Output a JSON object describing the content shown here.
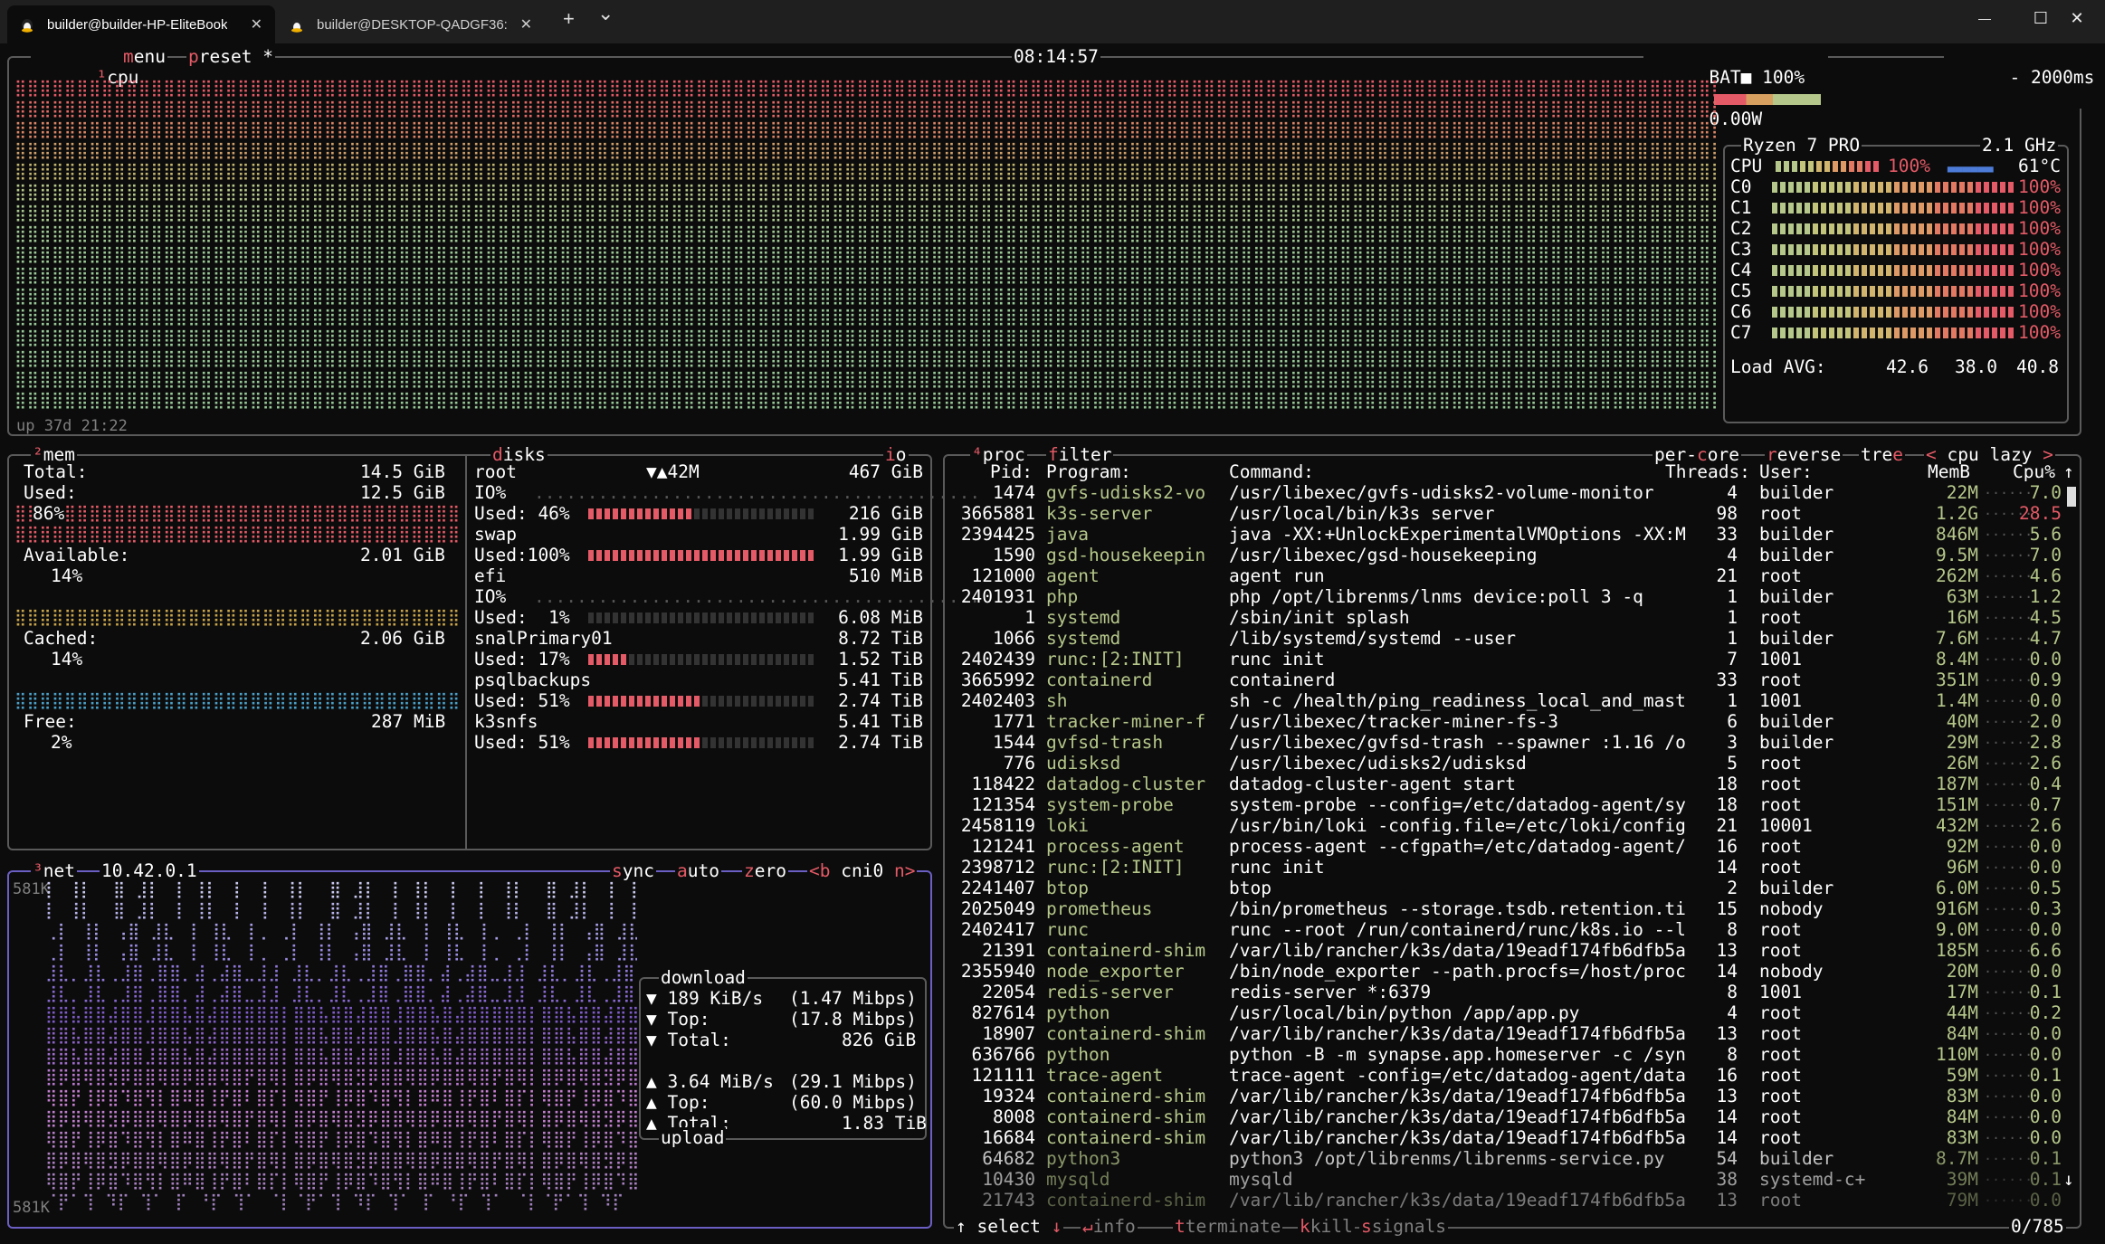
{
  "window": {
    "tabs": [
      {
        "title": "builder@builder-HP-EliteBook",
        "active": true
      },
      {
        "title": "builder@DESKTOP-QADGF36:",
        "active": false
      }
    ],
    "new_tab": "+",
    "dropdown": "⌄",
    "close_glyph": "✕",
    "controls": {
      "minimize": "—",
      "maximize": "☐",
      "close": "✕"
    }
  },
  "colors": {
    "accent_red": "#e45a66",
    "green": "#b5c78a",
    "border_gray": "#5a5a5a",
    "purple_border": "#6b5fc4"
  },
  "cpu": {
    "tab_num": "¹",
    "label": "cpu",
    "menu": "menu",
    "preset": "preset *",
    "clock": "08:14:57",
    "battery": "BAT■ 100%",
    "power": "0.00W",
    "interval": "2000ms",
    "minus": "-",
    "plus": "+",
    "uptime": "up 37d 21:22",
    "model": "Ryzen 7 PRO",
    "freq": "2.1 GHz",
    "total_label": "CPU",
    "total_pct": "100%",
    "temp": "61°C",
    "total_fraction": 1.0,
    "cores": [
      {
        "name": "C0",
        "pct": "100%",
        "value": 1.0
      },
      {
        "name": "C1",
        "pct": "100%",
        "value": 1.0
      },
      {
        "name": "C2",
        "pct": "100%",
        "value": 1.0
      },
      {
        "name": "C3",
        "pct": "100%",
        "value": 1.0
      },
      {
        "name": "C4",
        "pct": "100%",
        "value": 1.0
      },
      {
        "name": "C5",
        "pct": "100%",
        "value": 1.0
      },
      {
        "name": "C6",
        "pct": "100%",
        "value": 1.0
      },
      {
        "name": "C7",
        "pct": "100%",
        "value": 1.0
      }
    ],
    "load_label": "Load AVG:",
    "load": [
      "42.6",
      "38.0",
      "40.8"
    ]
  },
  "mem": {
    "tab_num": "²",
    "label": "mem",
    "total_label": "Total:",
    "total": "14.5 GiB",
    "used_label": "Used:",
    "used": "12.5 GiB",
    "used_pct": "86%",
    "available_label": "Available:",
    "available": "2.01 GiB",
    "available_pct": "14%",
    "cached_label": "Cached:",
    "cached": "2.06 GiB",
    "cached_pct": "14%",
    "free_label": "Free:",
    "free": "287 MiB",
    "free_pct": "2%"
  },
  "disks": {
    "label": "disks",
    "io_label": "io",
    "items": [
      {
        "name": "root",
        "io": "▼▲42M",
        "size": "467 GiB",
        "io_label": "IO%",
        "used_label": "Used: 46%",
        "used": "216 GiB",
        "fraction": 0.46
      },
      {
        "name": "swap",
        "size": "1.99 GiB",
        "used_label": "Used:100%",
        "used": "1.99 GiB",
        "fraction": 1.0
      },
      {
        "name": "efi",
        "size": "510 MiB",
        "io_label": "IO%",
        "used_label": "Used:  1%",
        "used": "6.08 MiB",
        "fraction": 0.01
      },
      {
        "name": "snalPrimary01",
        "size": "8.72 TiB",
        "used_label": "Used: 17%",
        "used": "1.52 TiB",
        "fraction": 0.17
      },
      {
        "name": "psqlbackups",
        "size": "5.41 TiB",
        "used_label": "Used: 51%",
        "used": "2.74 TiB",
        "fraction": 0.51
      },
      {
        "name": "k3snfs",
        "size": "5.41 TiB",
        "used_label": "Used: 51%",
        "used": "2.74 TiB",
        "fraction": 0.51
      }
    ]
  },
  "net": {
    "tab_num": "³",
    "label": "net",
    "ip": "10.42.0.1",
    "sync": "sync",
    "auto": "auto",
    "zero": "zero",
    "prev": "<b",
    "iface": "cni0",
    "next": "n>",
    "scale_top": "581K",
    "scale_bottom": "581K",
    "download_title": "download",
    "download_rate": "189 KiB/s",
    "download_mbps": "(1.47 Mibps)",
    "download_top_label": "Top:",
    "download_top": "(17.8 Mibps)",
    "download_total_label": "Total:",
    "download_total": "826 GiB",
    "upload_rate": "3.64 MiB/s",
    "upload_mbps": "(29.1 Mibps)",
    "upload_top_label": "Top:",
    "upload_top": "(60.0 Mibps)",
    "upload_total_label": "Total:",
    "upload_total": "1.83 TiB",
    "upload_title": "upload"
  },
  "proc": {
    "tab_num": "⁴",
    "label": "proc",
    "filter": "filter",
    "per_core": "per-core",
    "reverse": "reverse",
    "tree": "tree",
    "sort_prev": "<",
    "sort": "cpu lazy",
    "sort_next": ">",
    "columns": {
      "pid": "Pid:",
      "program": "Program:",
      "command": "Command:",
      "threads": "Threads:",
      "user": "User:",
      "mem": "MemB",
      "cpu": "Cpu%"
    },
    "rows": [
      {
        "pid": "1474",
        "program": "gvfs-udisks2-vo",
        "command": "/usr/libexec/gvfs-udisks2-volume-monitor",
        "threads": "4",
        "user": "builder",
        "mem": "22M",
        "cpu": "7.0"
      },
      {
        "pid": "3665881",
        "program": "k3s-server",
        "command": "/usr/local/bin/k3s server",
        "threads": "98",
        "user": "root",
        "mem": "1.2G",
        "cpu": "28.5"
      },
      {
        "pid": "2394425",
        "program": "java",
        "command": "java -XX:+UnlockExperimentalVMOptions -XX:M",
        "threads": "33",
        "user": "builder",
        "mem": "846M",
        "cpu": "5.6"
      },
      {
        "pid": "1590",
        "program": "gsd-housekeepin",
        "command": "/usr/libexec/gsd-housekeeping",
        "threads": "4",
        "user": "builder",
        "mem": "9.5M",
        "cpu": "7.0"
      },
      {
        "pid": "121000",
        "program": "agent",
        "command": "agent run",
        "threads": "21",
        "user": "root",
        "mem": "262M",
        "cpu": "4.6"
      },
      {
        "pid": "2401931",
        "program": "php",
        "command": "php /opt/librenms/lnms device:poll 3 -q",
        "threads": "1",
        "user": "builder",
        "mem": "63M",
        "cpu": "1.2"
      },
      {
        "pid": "1",
        "program": "systemd",
        "command": "/sbin/init splash",
        "threads": "1",
        "user": "root",
        "mem": "16M",
        "cpu": "4.5"
      },
      {
        "pid": "1066",
        "program": "systemd",
        "command": "/lib/systemd/systemd --user",
        "threads": "1",
        "user": "builder",
        "mem": "7.6M",
        "cpu": "4.7"
      },
      {
        "pid": "2402439",
        "program": "runc:[2:INIT]",
        "command": "runc init",
        "threads": "7",
        "user": "1001",
        "mem": "8.4M",
        "cpu": "0.0"
      },
      {
        "pid": "3665992",
        "program": "containerd",
        "command": "containerd",
        "threads": "33",
        "user": "root",
        "mem": "351M",
        "cpu": "0.9"
      },
      {
        "pid": "2402403",
        "program": "sh",
        "command": "sh -c /health/ping_readiness_local_and_mast",
        "threads": "1",
        "user": "1001",
        "mem": "1.4M",
        "cpu": "0.0"
      },
      {
        "pid": "1771",
        "program": "tracker-miner-f",
        "command": "/usr/libexec/tracker-miner-fs-3",
        "threads": "6",
        "user": "builder",
        "mem": "40M",
        "cpu": "2.0"
      },
      {
        "pid": "1544",
        "program": "gvfsd-trash",
        "command": "/usr/libexec/gvfsd-trash --spawner :1.16 /o",
        "threads": "3",
        "user": "builder",
        "mem": "29M",
        "cpu": "2.8"
      },
      {
        "pid": "776",
        "program": "udisksd",
        "command": "/usr/libexec/udisks2/udisksd",
        "threads": "5",
        "user": "root",
        "mem": "26M",
        "cpu": "2.6"
      },
      {
        "pid": "118422",
        "program": "datadog-cluster",
        "command": "datadog-cluster-agent start",
        "threads": "18",
        "user": "root",
        "mem": "187M",
        "cpu": "0.4"
      },
      {
        "pid": "121354",
        "program": "system-probe",
        "command": "system-probe --config=/etc/datadog-agent/sy",
        "threads": "18",
        "user": "root",
        "mem": "151M",
        "cpu": "0.7"
      },
      {
        "pid": "2458119",
        "program": "loki",
        "command": "/usr/bin/loki -config.file=/etc/loki/config",
        "threads": "21",
        "user": "10001",
        "mem": "432M",
        "cpu": "2.6"
      },
      {
        "pid": "121241",
        "program": "process-agent",
        "command": "process-agent --cfgpath=/etc/datadog-agent/",
        "threads": "16",
        "user": "root",
        "mem": "92M",
        "cpu": "0.0"
      },
      {
        "pid": "2398712",
        "program": "runc:[2:INIT]",
        "command": "runc init",
        "threads": "14",
        "user": "root",
        "mem": "96M",
        "cpu": "0.0"
      },
      {
        "pid": "2241407",
        "program": "btop",
        "command": "btop",
        "threads": "2",
        "user": "builder",
        "mem": "6.0M",
        "cpu": "0.5"
      },
      {
        "pid": "2025049",
        "program": "prometheus",
        "command": "/bin/prometheus --storage.tsdb.retention.ti",
        "threads": "15",
        "user": "nobody",
        "mem": "916M",
        "cpu": "0.3"
      },
      {
        "pid": "2402417",
        "program": "runc",
        "command": "runc --root /run/containerd/runc/k8s.io --l",
        "threads": "8",
        "user": "root",
        "mem": "9.0M",
        "cpu": "0.0"
      },
      {
        "pid": "21391",
        "program": "containerd-shim",
        "command": "/var/lib/rancher/k3s/data/19eadf174fb6dfb5a",
        "threads": "13",
        "user": "root",
        "mem": "185M",
        "cpu": "6.6"
      },
      {
        "pid": "2355940",
        "program": "node_exporter",
        "command": "/bin/node_exporter --path.procfs=/host/proc",
        "threads": "14",
        "user": "nobody",
        "mem": "20M",
        "cpu": "0.0"
      },
      {
        "pid": "22054",
        "program": "redis-server",
        "command": "redis-server *:6379",
        "threads": "8",
        "user": "1001",
        "mem": "17M",
        "cpu": "0.1"
      },
      {
        "pid": "827614",
        "program": "python",
        "command": "/usr/local/bin/python /app/app.py",
        "threads": "4",
        "user": "root",
        "mem": "44M",
        "cpu": "0.2"
      },
      {
        "pid": "18907",
        "program": "containerd-shim",
        "command": "/var/lib/rancher/k3s/data/19eadf174fb6dfb5a",
        "threads": "13",
        "user": "root",
        "mem": "84M",
        "cpu": "0.0"
      },
      {
        "pid": "636766",
        "program": "python",
        "command": "python -B -m synapse.app.homeserver -c /syn",
        "threads": "8",
        "user": "root",
        "mem": "110M",
        "cpu": "0.0"
      },
      {
        "pid": "121111",
        "program": "trace-agent",
        "command": "trace-agent -config=/etc/datadog-agent/data",
        "threads": "16",
        "user": "root",
        "mem": "59M",
        "cpu": "0.1"
      },
      {
        "pid": "19324",
        "program": "containerd-shim",
        "command": "/var/lib/rancher/k3s/data/19eadf174fb6dfb5a",
        "threads": "13",
        "user": "root",
        "mem": "83M",
        "cpu": "0.0"
      },
      {
        "pid": "8008",
        "program": "containerd-shim",
        "command": "/var/lib/rancher/k3s/data/19eadf174fb6dfb5a",
        "threads": "14",
        "user": "root",
        "mem": "84M",
        "cpu": "0.0"
      },
      {
        "pid": "16684",
        "program": "containerd-shim",
        "command": "/var/lib/rancher/k3s/data/19eadf174fb6dfb5a",
        "threads": "14",
        "user": "root",
        "mem": "83M",
        "cpu": "0.0"
      },
      {
        "pid": "64682",
        "program": "python3",
        "command": "python3 /opt/librenms/librenms-service.py",
        "threads": "54",
        "user": "builder",
        "mem": "8.7M",
        "cpu": "0.1"
      },
      {
        "pid": "10430",
        "program": "mysqld",
        "command": "mysqld",
        "threads": "38",
        "user": "systemd-c+",
        "mem": "39M",
        "cpu": "0.1"
      },
      {
        "pid": "21743",
        "program": "containerd-shim",
        "command": "/var/lib/rancher/k3s/data/19eadf174fb6dfb5a",
        "threads": "13",
        "user": "root",
        "mem": "79M",
        "cpu": "0.0"
      }
    ],
    "footer": {
      "select": "select",
      "info": "info",
      "terminate": "terminate",
      "kill": "kill",
      "signals": "signals",
      "count": "0/785"
    }
  }
}
